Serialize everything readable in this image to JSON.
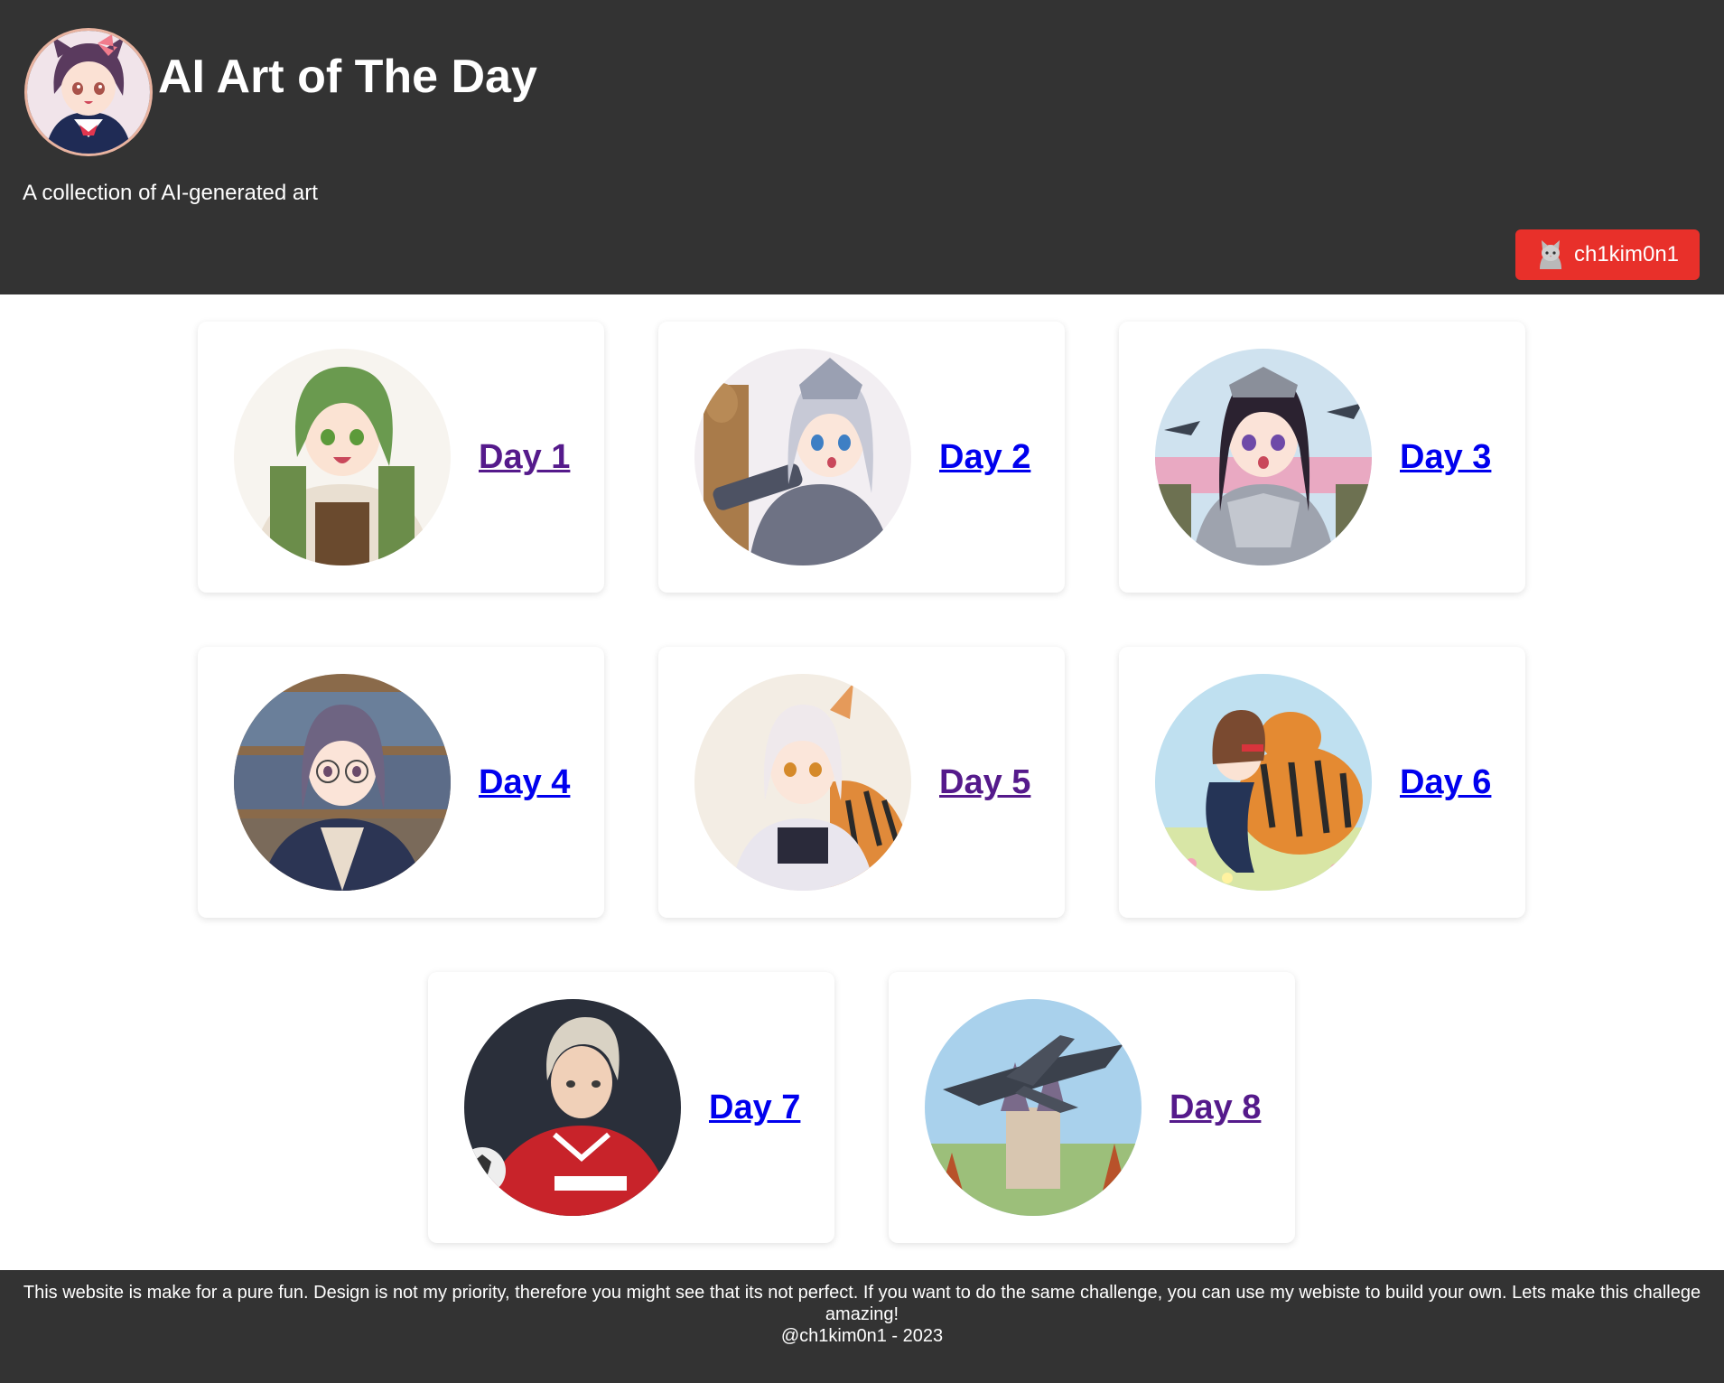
{
  "header": {
    "title": "AI Art of The Day",
    "tagline": "A collection of AI-generated art",
    "logo_icon": "anime-girl-avatar",
    "user_button": {
      "label": "ch1kim0n1",
      "icon": "cat-avatar-icon",
      "color": "#e8302a"
    }
  },
  "colors": {
    "header_bg": "#333333",
    "link": "#0000ee",
    "link_visited": "#551a8b"
  },
  "cards": [
    {
      "label": "Day 1",
      "visited": true,
      "image": "green-haired-girl-with-backpack"
    },
    {
      "label": "Day 2",
      "visited": false,
      "image": "silver-haired-knight-girl"
    },
    {
      "label": "Day 3",
      "visited": false,
      "image": "armored-dark-haired-girl-with-jets"
    },
    {
      "label": "Day 4",
      "visited": false,
      "image": "girl-with-glasses-in-library"
    },
    {
      "label": "Day 5",
      "visited": true,
      "image": "white-haired-fox-girl-with-tiger"
    },
    {
      "label": "Day 6",
      "visited": false,
      "image": "girl-hugging-tiger-in-flowers"
    },
    {
      "label": "Day 7",
      "visited": false,
      "image": "soccer-player-in-red-jersey"
    },
    {
      "label": "Day 8",
      "visited": true,
      "image": "fighter-jet-over-castle"
    }
  ],
  "footer": {
    "message": "This website is make for a pure fun. Design is not my priority, therefore you might see that its not perfect. If you want to do the same challenge, you can use my webiste to build your own. Lets make this challege amazing!",
    "credit": "@ch1kim0n1 - 2023"
  }
}
